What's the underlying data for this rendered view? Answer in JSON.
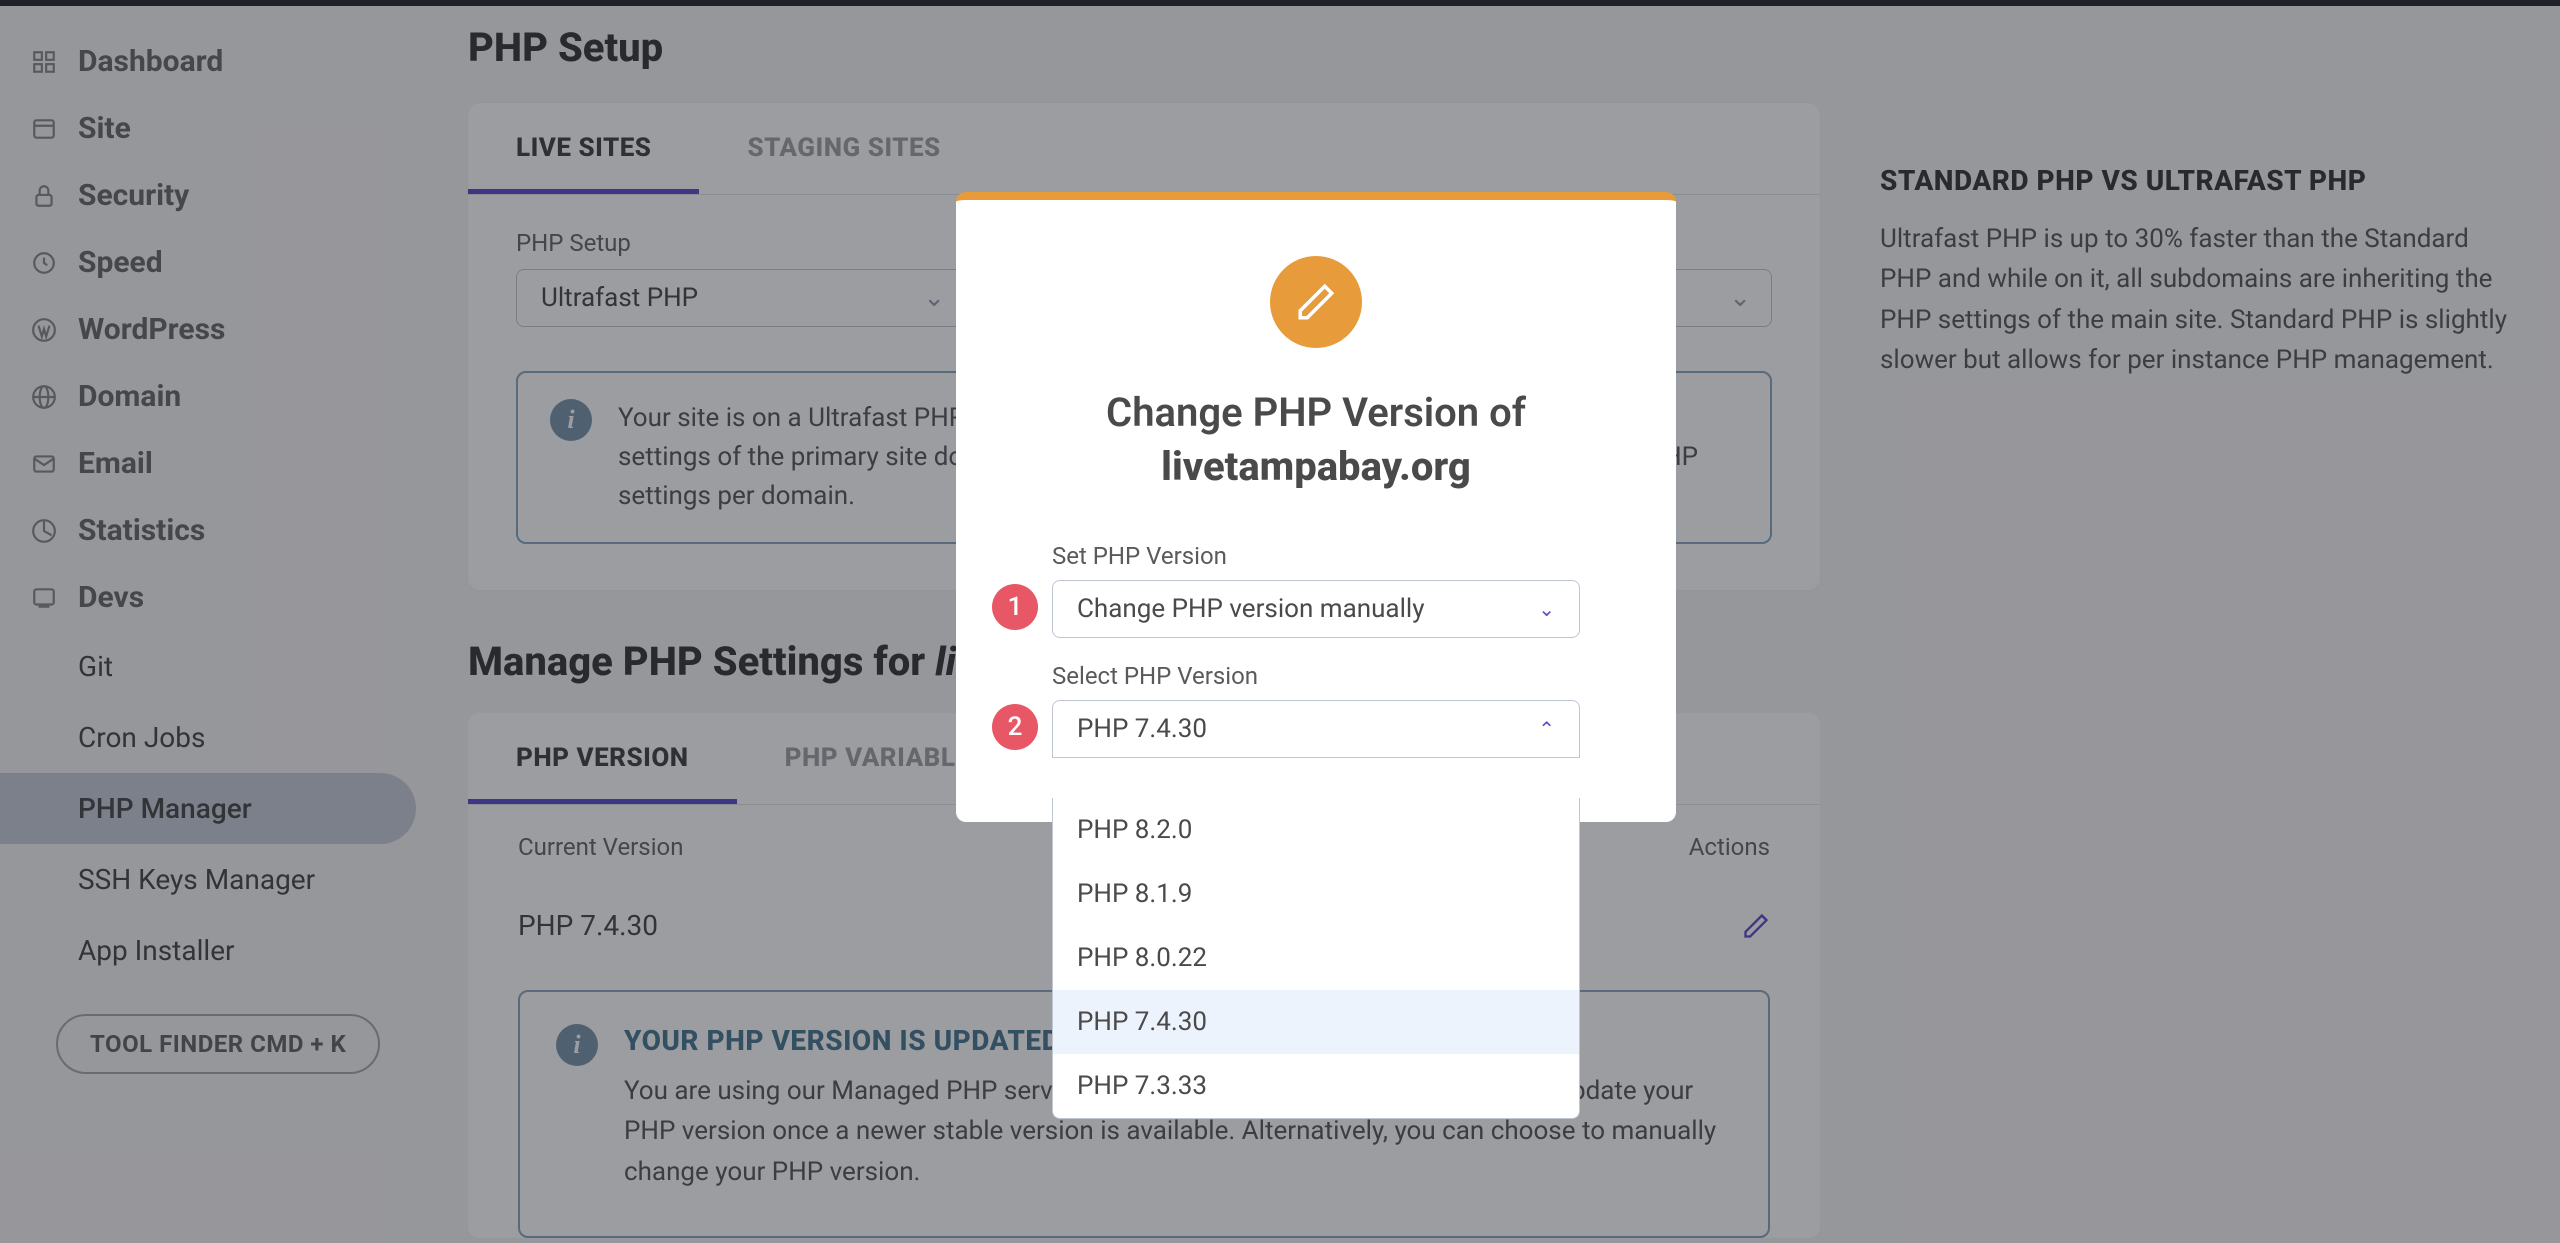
{
  "sidebar": {
    "items": [
      {
        "label": "Dashboard",
        "icon": "dashboard"
      },
      {
        "label": "Site",
        "icon": "site"
      },
      {
        "label": "Security",
        "icon": "security"
      },
      {
        "label": "Speed",
        "icon": "speed"
      },
      {
        "label": "WordPress",
        "icon": "wordpress"
      },
      {
        "label": "Domain",
        "icon": "domain"
      },
      {
        "label": "Email",
        "icon": "email"
      },
      {
        "label": "Statistics",
        "icon": "statistics"
      },
      {
        "label": "Devs",
        "icon": "devs"
      }
    ],
    "subitems": [
      {
        "label": "Git"
      },
      {
        "label": "Cron Jobs"
      },
      {
        "label": "PHP Manager",
        "active": true
      },
      {
        "label": "SSH Keys Manager"
      },
      {
        "label": "App Installer"
      }
    ],
    "tool_finder": "TOOL FINDER CMD + K"
  },
  "page": {
    "title": "PHP Setup",
    "tabs": [
      {
        "label": "LIVE SITES",
        "active": true
      },
      {
        "label": "STAGING SITES"
      }
    ],
    "setup_label": "PHP Setup",
    "setup_value": "Ultrafast PHP",
    "info1": "Your site is on a Ultrafast PHP setup which means that all of your domains inherit the PHP settings of the primary site domain. Switch to Standard PHP if you want to have separate PHP settings per domain.",
    "section_title_prefix": "Manage PHP Settings for ",
    "section_title_domain": "livetampabay.org",
    "tabs2": [
      {
        "label": "PHP VERSION",
        "active": true
      },
      {
        "label": "PHP VARIABLES"
      }
    ],
    "table_head_left": "Current Version",
    "table_head_right": "Actions",
    "current_version": "PHP 7.4.30",
    "info2_title": "YOUR PHP VERSION IS UPDATED AUTOMATICALLY",
    "info2_body": "You are using our Managed PHP service, which means that we will automatically update your PHP version once a newer stable version is available. Alternatively, you can choose to manually change your PHP version."
  },
  "right": {
    "title": "STANDARD PHP VS ULTRAFAST PHP",
    "body": "Ultrafast PHP is up to 30% faster than the Standard PHP and while on it, all subdomains are inheriting the PHP settings of the main site. Standard PHP is slightly slower but allows for per instance PHP management."
  },
  "modal": {
    "title_prefix": "Change PHP Version of",
    "domain": "livetampabay.org",
    "badge1": "1",
    "badge2": "2",
    "field1_label": "Set PHP Version",
    "field1_value": "Change PHP version manually",
    "field2_label": "Select PHP Version",
    "field2_value": "PHP 7.4.30",
    "options": [
      {
        "label": "PHP 8.2.0"
      },
      {
        "label": "PHP 8.1.9"
      },
      {
        "label": "PHP 8.0.22"
      },
      {
        "label": "PHP 7.4.30",
        "selected": true
      },
      {
        "label": "PHP 7.3.33"
      }
    ]
  }
}
